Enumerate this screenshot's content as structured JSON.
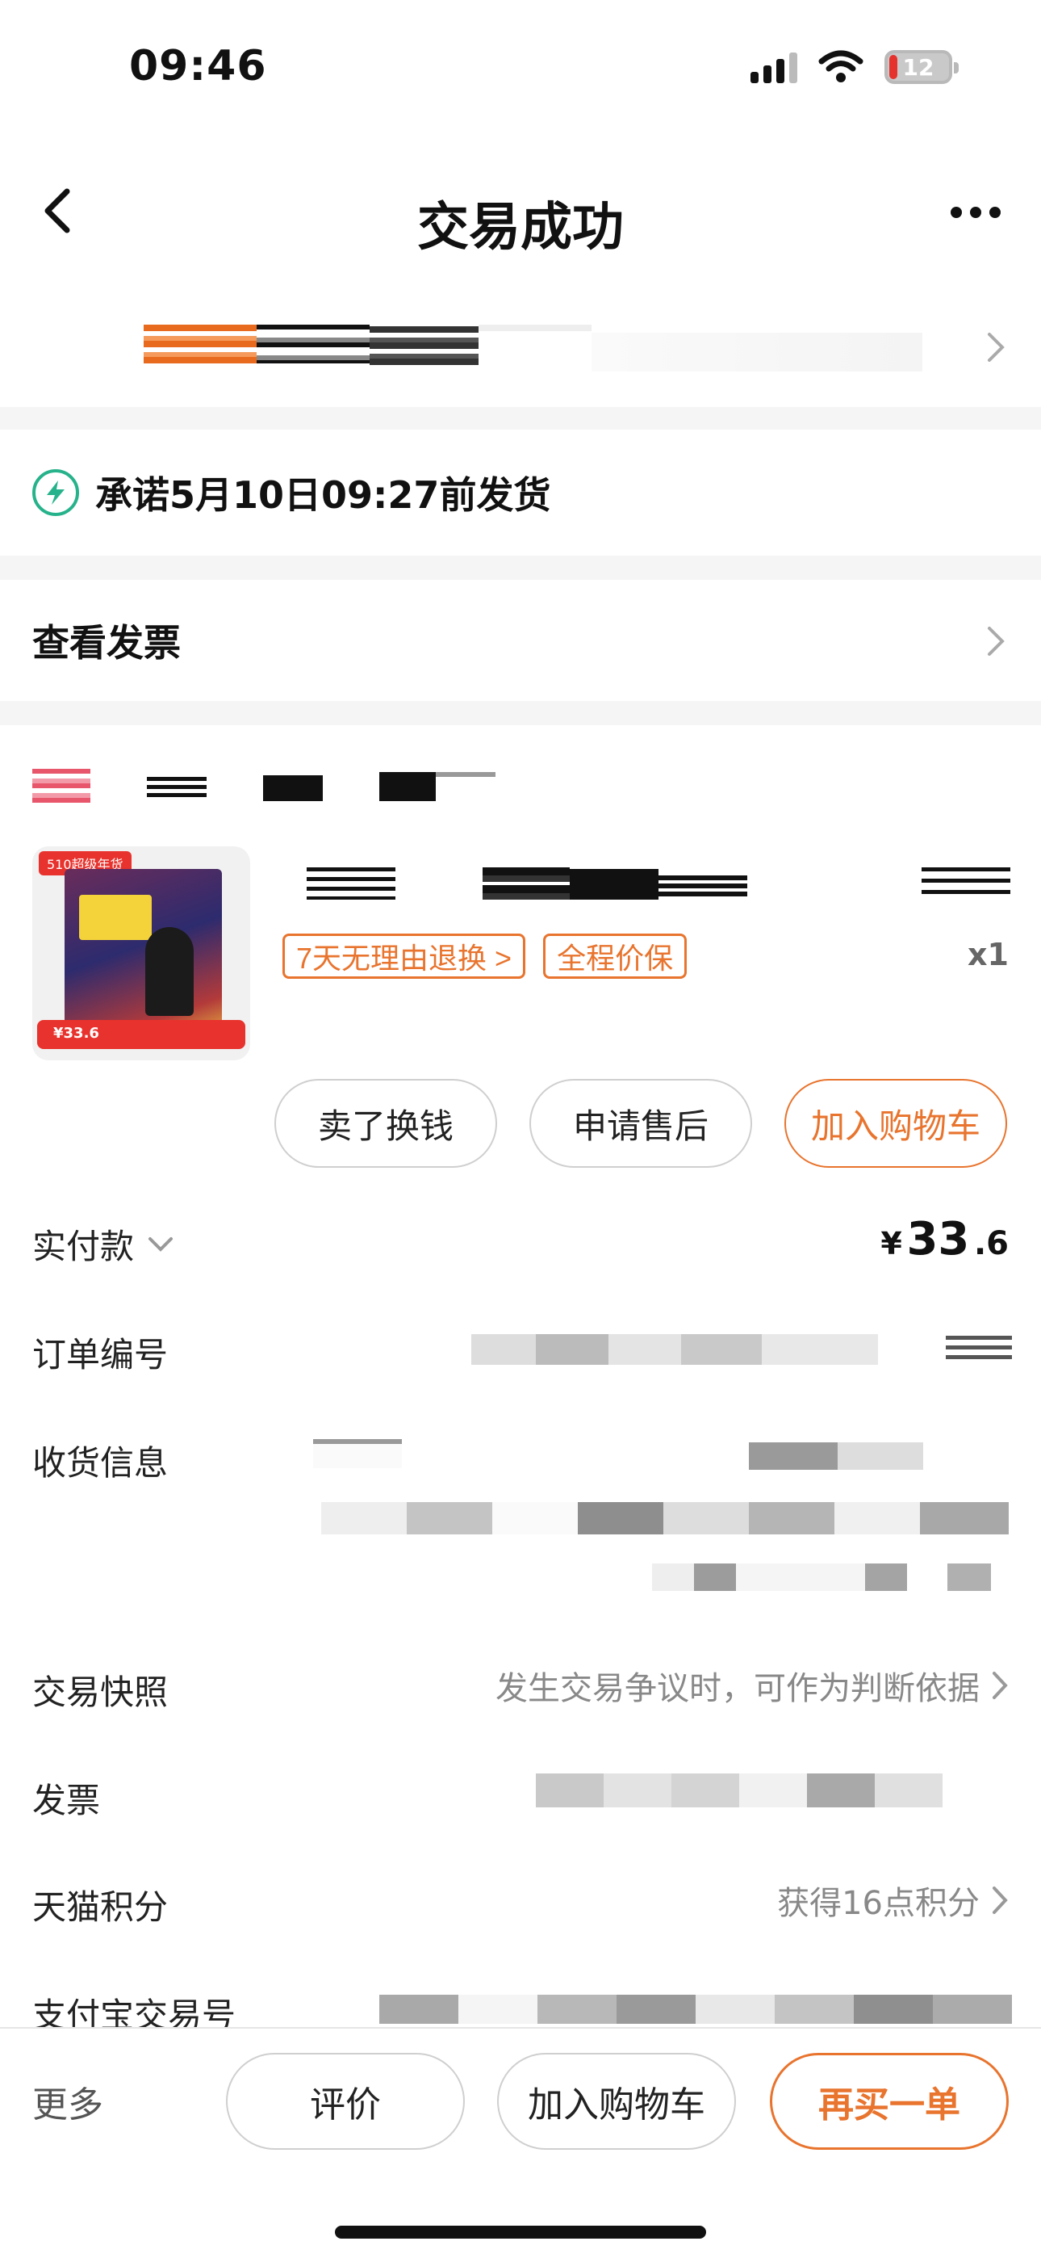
{
  "status_bar": {
    "time": "09:46",
    "battery_level": "12"
  },
  "nav": {
    "title": "交易成功"
  },
  "delivery_promise": {
    "text": "承诺5月10日09:27前发货"
  },
  "invoice_link": {
    "label": "查看发票"
  },
  "product": {
    "cover_badge": "510超级年货",
    "cover_price": "¥33.6",
    "tags": [
      "7天无理由退换 >",
      "全程价保"
    ],
    "quantity": "x1",
    "actions": [
      "卖了换钱",
      "申请售后",
      "加入购物车"
    ]
  },
  "order_info": {
    "paid_label": "实付款",
    "paid_currency": "¥",
    "paid_int": "33",
    "paid_dec": ".6",
    "order_no_label": "订单编号",
    "shipping_label": "收货信息",
    "snapshot_label": "交易快照",
    "snapshot_value": "发生交易争议时，可作为判断依据",
    "invoice_label": "发票",
    "points_label": "天猫积分",
    "points_value": "获得16点积分",
    "alipay_label": "支付宝交易号"
  },
  "bottom_bar": {
    "more_label": "更多",
    "review_label": "评价",
    "add_cart_label": "加入购物车",
    "rebuy_label": "再买一单"
  },
  "colors": {
    "accent": "#e8742e",
    "bolt": "#26b28a",
    "gap": "#f5f5f5"
  }
}
